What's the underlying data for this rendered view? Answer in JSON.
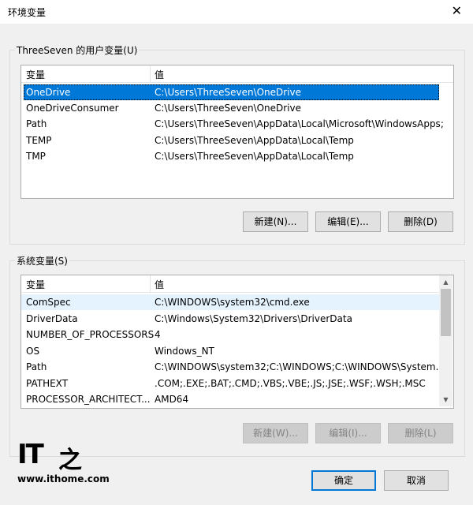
{
  "window": {
    "title": "环境变量",
    "close_glyph": "✕"
  },
  "user_group": {
    "label": "ThreeSeven 的用户变量(U)",
    "columns": [
      "变量",
      "值"
    ],
    "rows": [
      {
        "name": "OneDrive",
        "value": "C:\\Users\\ThreeSeven\\OneDrive"
      },
      {
        "name": "OneDriveConsumer",
        "value": "C:\\Users\\ThreeSeven\\OneDrive"
      },
      {
        "name": "Path",
        "value": "C:\\Users\\ThreeSeven\\AppData\\Local\\Microsoft\\WindowsApps;"
      },
      {
        "name": "TEMP",
        "value": "C:\\Users\\ThreeSeven\\AppData\\Local\\Temp"
      },
      {
        "name": "TMP",
        "value": "C:\\Users\\ThreeSeven\\AppData\\Local\\Temp"
      }
    ],
    "buttons": {
      "new": "新建(N)...",
      "edit": "编辑(E)...",
      "delete": "删除(D)"
    }
  },
  "system_group": {
    "label": "系统变量(S)",
    "columns": [
      "变量",
      "值"
    ],
    "rows": [
      {
        "name": "ComSpec",
        "value": "C:\\WINDOWS\\system32\\cmd.exe"
      },
      {
        "name": "DriverData",
        "value": "C:\\Windows\\System32\\Drivers\\DriverData"
      },
      {
        "name": "NUMBER_OF_PROCESSORS",
        "value": "4"
      },
      {
        "name": "OS",
        "value": "Windows_NT"
      },
      {
        "name": "Path",
        "value": "C:\\WINDOWS\\system32;C:\\WINDOWS;C:\\WINDOWS\\System..."
      },
      {
        "name": "PATHEXT",
        "value": ".COM;.EXE;.BAT;.CMD;.VBS;.VBE;.JS;.JSE;.WSF;.WSH;.MSC"
      },
      {
        "name": "PROCESSOR_ARCHITECT...",
        "value": "AMD64"
      }
    ],
    "buttons": {
      "new": "新建(W)...",
      "edit": "编辑(I)...",
      "delete": "删除(L)"
    }
  },
  "footer": {
    "ok": "确定",
    "cancel": "取消"
  },
  "watermark": {
    "logo": "IT之家",
    "url": "www.ithome.com"
  },
  "colors": {
    "accent": "#0078d7",
    "background": "#f0f0f0"
  }
}
